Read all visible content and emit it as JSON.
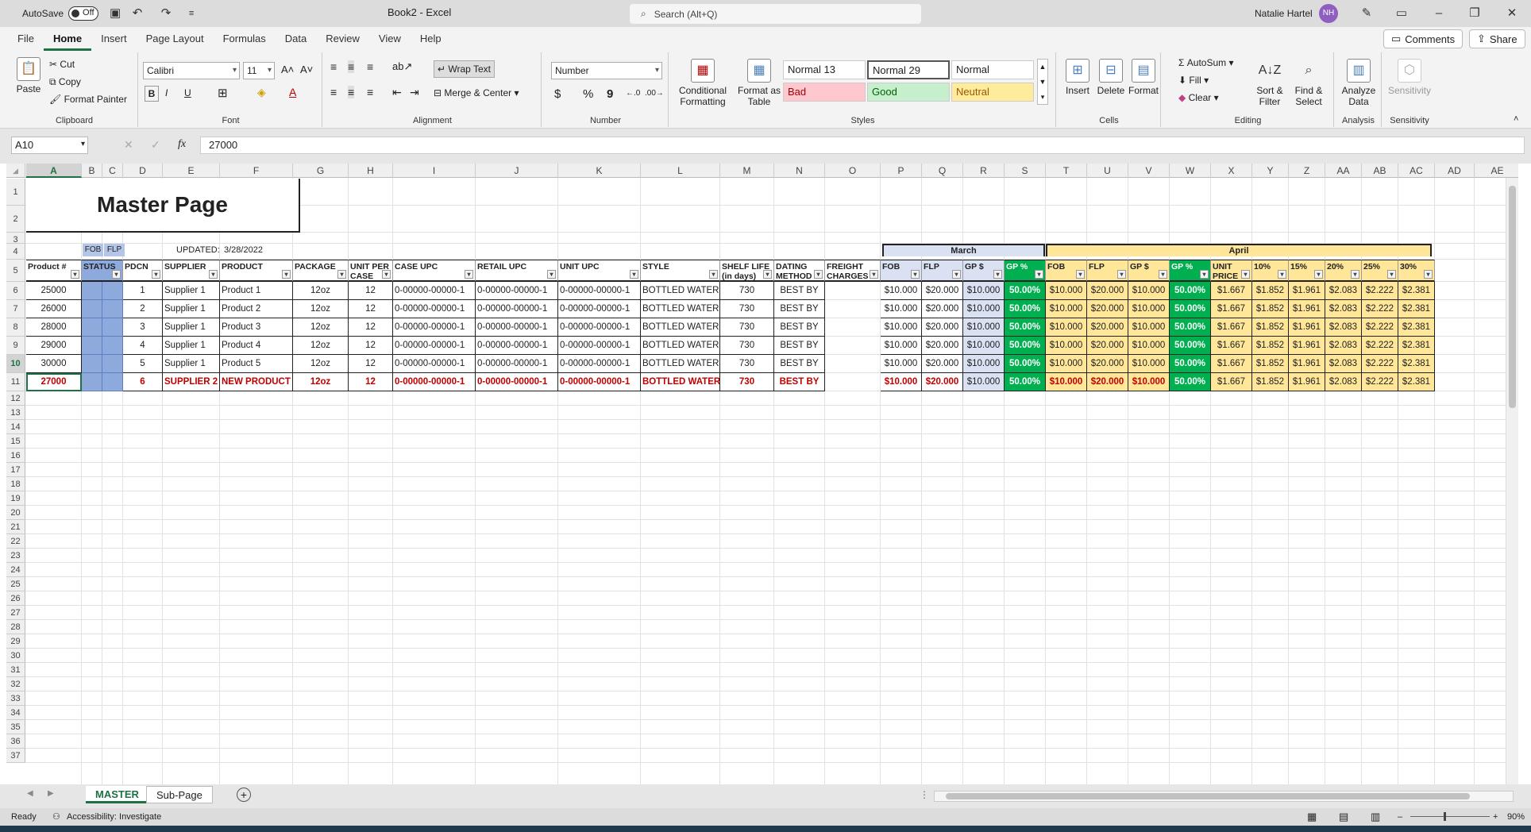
{
  "titlebar": {
    "autosave": "AutoSave",
    "autosave_state": "Off",
    "book": "Book2  -  Excel",
    "search": "Search (Alt+Q)",
    "user": "Natalie Hartel",
    "initials": "NH"
  },
  "menu": {
    "tabs": [
      "File",
      "Home",
      "Insert",
      "Page Layout",
      "Formulas",
      "Data",
      "Review",
      "View",
      "Help"
    ],
    "comments": "Comments",
    "share": "Share"
  },
  "ribbon": {
    "clipboard": {
      "paste": "Paste",
      "cut": "Cut",
      "copy": "Copy",
      "format_painter": "Format Painter",
      "label": "Clipboard"
    },
    "font": {
      "family": "Calibri",
      "size": "11",
      "label": "Font",
      "bold": "B",
      "italic": "I",
      "underline": "U"
    },
    "alignment": {
      "wrap": "Wrap Text",
      "merge": "Merge & Center",
      "label": "Alignment"
    },
    "number": {
      "format": "Number",
      "label": "Number",
      "currency": "$",
      "percent": "%",
      "comma": "9"
    },
    "styles": {
      "conditional": "Conditional Formatting",
      "format_table": "Format as Table",
      "normal13": "Normal 13",
      "normal29": "Normal 29",
      "normal": "Normal",
      "bad": "Bad",
      "good": "Good",
      "neutral": "Neutral",
      "label": "Styles"
    },
    "cells": {
      "insert": "Insert",
      "delete": "Delete",
      "format": "Format",
      "label": "Cells"
    },
    "editing": {
      "autosum": "AutoSum",
      "fill": "Fill",
      "clear": "Clear",
      "sort": "Sort & Filter",
      "find": "Find & Select",
      "label": "Editing"
    },
    "analysis": {
      "analyze": "Analyze Data",
      "label": "Analysis"
    },
    "sensitivity": {
      "btn": "Sensitivity",
      "label": "Sensitivity"
    }
  },
  "formula": {
    "namebox": "A10",
    "value": "27000",
    "fx": "fx"
  },
  "columns": [
    "A",
    "B",
    "C",
    "D",
    "E",
    "F",
    "G",
    "H",
    "I",
    "J",
    "K",
    "L",
    "M",
    "N",
    "O",
    "P",
    "Q",
    "R",
    "S",
    "T",
    "U",
    "V",
    "W",
    "X",
    "Y",
    "Z",
    "AA",
    "AB",
    "AC",
    "AD",
    "AE"
  ],
  "sheet": {
    "title": "Master Page",
    "updated_label": "UPDATED:",
    "updated_date": "3/28/2022",
    "fob": "FOB",
    "flp": "FLP",
    "march": "March",
    "april": "April",
    "headers": [
      "Product #",
      "STATUS",
      "PDCN",
      "SUPPLIER",
      "PRODUCT",
      "PACKAGE",
      "UNIT PER CASE",
      "CASE UPC",
      "RETAIL UPC",
      "UNIT UPC",
      "STYLE",
      "SHELF LIFE (in days)",
      "DATING METHOD",
      "FREIGHT CHARGES",
      "FOB",
      "FLP",
      "GP $",
      "GP %",
      "FOB",
      "FLP",
      "GP $",
      "GP %",
      "UNIT PRICE",
      "10%",
      "15%",
      "20%",
      "25%",
      "30%"
    ],
    "rows": [
      [
        "25000",
        "1",
        "Supplier 1",
        "Product 1",
        "12oz",
        "12",
        "0-00000-00000-1",
        "0-00000-00000-1",
        "0-00000-00000-1",
        "BOTTLED WATER",
        "730",
        "BEST BY",
        "$10.000",
        "$20.000",
        "$10.000",
        "50.00%",
        "$10.000",
        "$20.000",
        "$10.000",
        "50.00%",
        "$1.667",
        "$1.852",
        "$1.961",
        "$2.083",
        "$2.222",
        "$2.381"
      ],
      [
        "26000",
        "2",
        "Supplier 1",
        "Product 2",
        "12oz",
        "12",
        "0-00000-00000-1",
        "0-00000-00000-1",
        "0-00000-00000-1",
        "BOTTLED WATER",
        "730",
        "BEST BY",
        "$10.000",
        "$20.000",
        "$10.000",
        "50.00%",
        "$10.000",
        "$20.000",
        "$10.000",
        "50.00%",
        "$1.667",
        "$1.852",
        "$1.961",
        "$2.083",
        "$2.222",
        "$2.381"
      ],
      [
        "28000",
        "3",
        "Supplier 1",
        "Product 3",
        "12oz",
        "12",
        "0-00000-00000-1",
        "0-00000-00000-1",
        "0-00000-00000-1",
        "BOTTLED WATER",
        "730",
        "BEST BY",
        "$10.000",
        "$20.000",
        "$10.000",
        "50.00%",
        "$10.000",
        "$20.000",
        "$10.000",
        "50.00%",
        "$1.667",
        "$1.852",
        "$1.961",
        "$2.083",
        "$2.222",
        "$2.381"
      ],
      [
        "29000",
        "4",
        "Supplier 1",
        "Product 4",
        "12oz",
        "12",
        "0-00000-00000-1",
        "0-00000-00000-1",
        "0-00000-00000-1",
        "BOTTLED WATER",
        "730",
        "BEST BY",
        "$10.000",
        "$20.000",
        "$10.000",
        "50.00%",
        "$10.000",
        "$20.000",
        "$10.000",
        "50.00%",
        "$1.667",
        "$1.852",
        "$1.961",
        "$2.083",
        "$2.222",
        "$2.381"
      ],
      [
        "30000",
        "5",
        "Supplier 1",
        "Product 5",
        "12oz",
        "12",
        "0-00000-00000-1",
        "0-00000-00000-1",
        "0-00000-00000-1",
        "BOTTLED WATER",
        "730",
        "BEST BY",
        "$10.000",
        "$20.000",
        "$10.000",
        "50.00%",
        "$10.000",
        "$20.000",
        "$10.000",
        "50.00%",
        "$1.667",
        "$1.852",
        "$1.961",
        "$2.083",
        "$2.222",
        "$2.381"
      ],
      [
        "27000",
        "6",
        "SUPPLIER 2",
        "NEW PRODUCT",
        "12oz",
        "12",
        "0-00000-00000-1",
        "0-00000-00000-1",
        "0-00000-00000-1",
        "BOTTLED WATER",
        "730",
        "BEST BY",
        "$10.000",
        "$20.000",
        "$10.000",
        "50.00%",
        "$10.000",
        "$20.000",
        "$10.000",
        "50.00%",
        "$1.667",
        "$1.852",
        "$1.961",
        "$2.083",
        "$2.222",
        "$2.381"
      ]
    ]
  },
  "sheets": {
    "active": "MASTER",
    "other": "Sub-Page"
  },
  "status": {
    "ready": "Ready",
    "accessibility": "Accessibility: Investigate",
    "zoom": "90%"
  },
  "colors": {
    "green": "#1e7145",
    "march": "#d9e1f2",
    "april": "#ffe699",
    "gp_green": "#00b050",
    "status_blue": "#8ea9db",
    "red": "#c00000"
  }
}
